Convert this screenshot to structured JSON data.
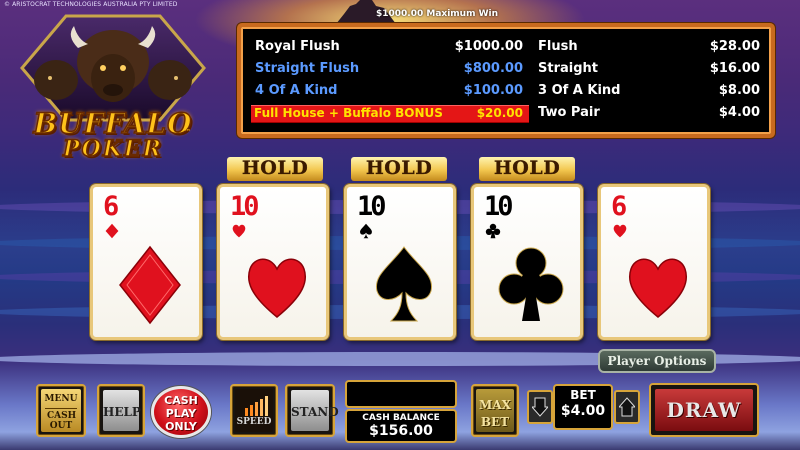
{
  "header": {
    "copyright": "© ARISTOCRAT TECHNOLOGIES AUSTRALIA PTY LIMITED",
    "max_win": "$1000.00 Maximum Win"
  },
  "logo": {
    "line1": "BUFFALO",
    "line2": "POKER",
    "tm": "™"
  },
  "paytable": {
    "left": [
      {
        "name": "Royal Flush",
        "value": "$1000.00",
        "highlight": "none"
      },
      {
        "name": "Straight Flush",
        "value": "$800.00",
        "highlight": "blue"
      },
      {
        "name": "4 Of A Kind",
        "value": "$100.00",
        "highlight": "blue"
      },
      {
        "name": "Full House + Buffalo BONUS",
        "value": "$20.00",
        "highlight": "bonus"
      }
    ],
    "right": [
      {
        "name": "Flush",
        "value": "$28.00"
      },
      {
        "name": "Straight",
        "value": "$16.00"
      },
      {
        "name": "3 Of A Kind",
        "value": "$8.00"
      },
      {
        "name": "Two Pair",
        "value": "$4.00"
      }
    ]
  },
  "hold_label": "HOLD",
  "cards": [
    {
      "rank": "6",
      "suit": "diamonds",
      "held": false
    },
    {
      "rank": "10",
      "suit": "hearts",
      "held": true
    },
    {
      "rank": "10",
      "suit": "spades",
      "held": true
    },
    {
      "rank": "10",
      "suit": "clubs",
      "held": true
    },
    {
      "rank": "6",
      "suit": "hearts",
      "held": false
    }
  ],
  "player_options_label": "Player Options",
  "buttons": {
    "menu": "MENU",
    "cash_out": "CASH OUT",
    "help": "HELP",
    "cash_play_only": [
      "CASH",
      "PLAY",
      "ONLY"
    ],
    "speed": "SPEED",
    "stand": "STAND",
    "max_bet": [
      "MAX",
      "BET"
    ],
    "draw": "DRAW"
  },
  "cash_balance": {
    "label": "CASH BALANCE",
    "amount": "$156.00"
  },
  "bet": {
    "label": "BET",
    "amount": "$4.00"
  },
  "colors": {
    "paytable_border": "#c86a1e",
    "bonus_bg": "#e41616",
    "bonus_text": "#ffe200",
    "highlight_blue": "#5b9aff",
    "red_suit": "#e0111e",
    "hold_gold": "#f2c64e"
  }
}
